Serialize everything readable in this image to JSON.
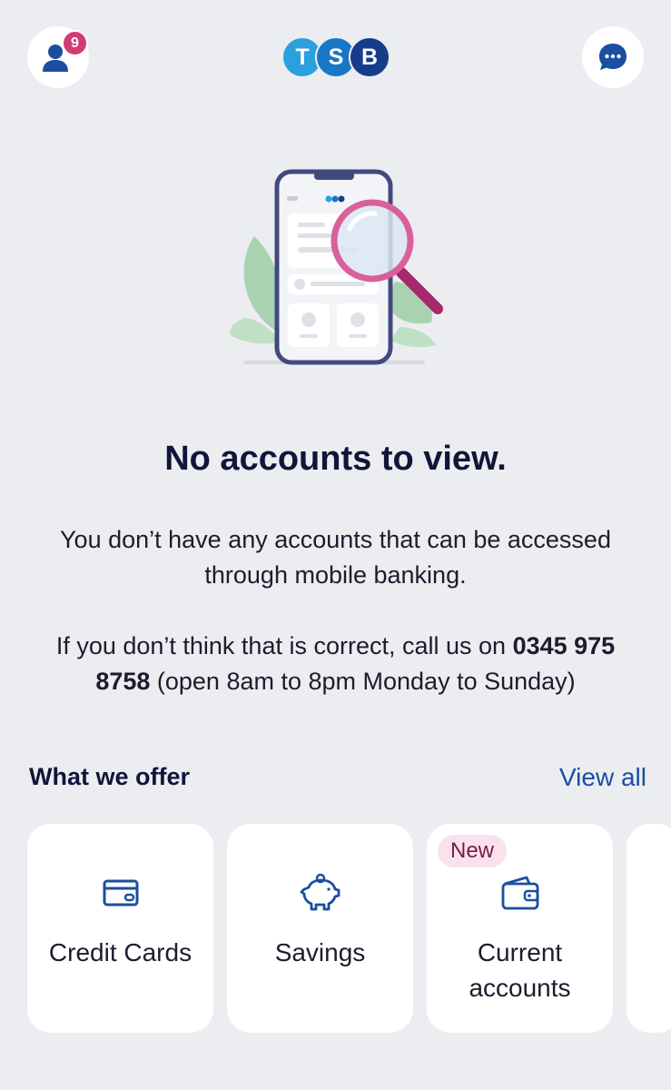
{
  "header": {
    "notification_count": "9",
    "logo_letters": [
      "T",
      "S",
      "B"
    ],
    "logo_colors": [
      "#2aa0de",
      "#1877c6",
      "#173c8c"
    ],
    "profile_icon": "user-icon",
    "chat_icon": "chat-bubble-icon"
  },
  "empty_state": {
    "title": "No accounts to view.",
    "message": "You don’t have any accounts that can be accessed through mobile banking.",
    "help_prefix": "If you don’t think that is correct, call us on ",
    "phone": "0345 975 8758",
    "help_suffix": " (open 8am to 8pm Monday to Sunday)"
  },
  "offers": {
    "title": "What we offer",
    "view_all": "View all",
    "cards": [
      {
        "label": "Credit Cards",
        "icon": "credit-card-icon"
      },
      {
        "label": "Savings",
        "icon": "piggy-bank-icon"
      },
      {
        "label": "Current accounts",
        "icon": "wallet-icon",
        "badge": "New"
      }
    ]
  },
  "colors": {
    "accent": "#1a4ea0",
    "badge": "#d23c74",
    "background": "#ecedf1"
  }
}
